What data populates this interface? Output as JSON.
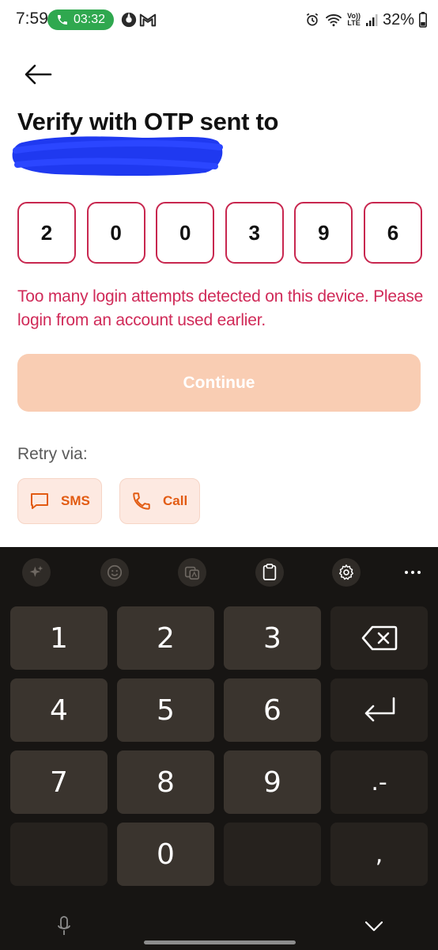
{
  "status_bar": {
    "time": "7:59",
    "call_timer": "03:32",
    "battery": "32%",
    "network_badge_top": "Vo))",
    "network_badge_bottom": "LTE"
  },
  "header": {
    "title": "Verify with OTP sent to"
  },
  "otp": {
    "digits": [
      "2",
      "0",
      "0",
      "3",
      "9",
      "6"
    ]
  },
  "error": {
    "message": "Too many login attempts detected on this device. Please login from an account used earlier."
  },
  "actions": {
    "continue_label": "Continue",
    "retry_label": "Retry via:",
    "sms_label": "SMS",
    "call_label": "Call"
  },
  "keyboard": {
    "keys": [
      "1",
      "2",
      "3",
      "4",
      "5",
      "6",
      "7",
      "8",
      "9",
      "0"
    ],
    "dot_dash": ".-",
    "comma": ","
  },
  "colors": {
    "accent_error": "#d02a58",
    "otp_border": "#c8274f",
    "continue_disabled": "#f9cdb3",
    "retry_accent": "#e25b12",
    "call_pill": "#2fa84f",
    "keyboard_bg": "#171513"
  },
  "icons": {
    "back": "arrow-left-icon",
    "sms": "chat-bubble-icon",
    "call": "phone-icon",
    "kb_ai": "sparkle-icon",
    "kb_emoji": "emoji-icon",
    "kb_translate": "translate-icon",
    "kb_clipboard": "clipboard-icon",
    "kb_settings": "gear-icon",
    "kb_more": "more-icon",
    "backspace": "backspace-icon",
    "enter": "enter-icon",
    "mic": "microphone-icon",
    "collapse": "chevron-down-icon"
  }
}
